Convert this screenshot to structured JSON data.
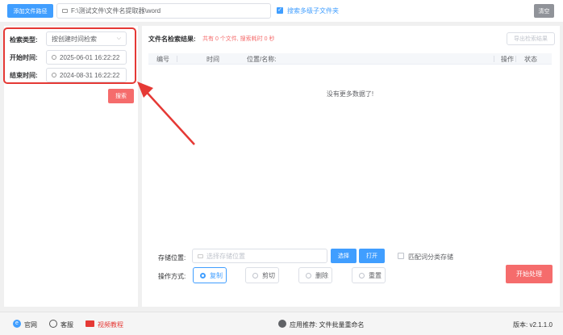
{
  "toolbar": {
    "add_path_label": "添加文件路径",
    "path_value": "F:\\测试文件\\文件名提取器\\word",
    "search_subfolders_label": "搜索多级子文件夹",
    "clear_label": "清空"
  },
  "search_panel": {
    "type_label": "检索类型:",
    "type_value": "按创建时间检索",
    "start_label": "开始时间:",
    "start_value": "2025-06-01 16:22:22",
    "end_label": "结束时间:",
    "end_value": "2024-08-31 16:22:22",
    "search_button": "搜索"
  },
  "results": {
    "title": "文件名检索结果:",
    "summary": "共有 0 个文件, 搜索耗时 0 秒",
    "export_label": "导出检索结果",
    "columns": [
      "编号",
      "时间",
      "位置/名称:",
      "操作",
      "状态"
    ],
    "empty_text": "没有更多数据了!"
  },
  "storage": {
    "label": "存储位置:",
    "placeholder": "选择存储位置",
    "choose_label": "选择",
    "open_label": "打开",
    "match_label": "匹配词分类存储"
  },
  "operation": {
    "label": "操作方式:",
    "options": [
      "复制",
      "剪切",
      "删除",
      "重置"
    ],
    "selected": "复制",
    "start_label": "开始处理"
  },
  "footer": {
    "website": "官网",
    "support": "客服",
    "video": "视频教程",
    "recommend": "应用推荐: 文件批量重命名",
    "version": "版本: v2.1.1.0"
  },
  "colors": {
    "accent": "#409eff",
    "danger": "#f56c6c",
    "highlight": "#e53935"
  }
}
